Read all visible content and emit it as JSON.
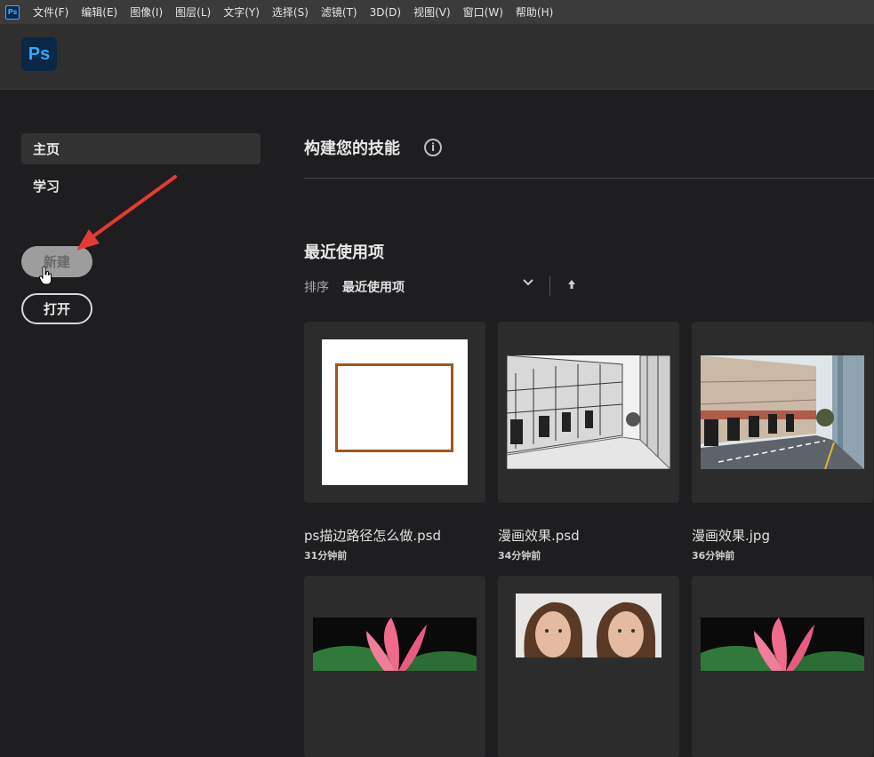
{
  "menubar": {
    "app_icon": "Ps",
    "items": [
      "文件(F)",
      "编辑(E)",
      "图像(I)",
      "图层(L)",
      "文字(Y)",
      "选择(S)",
      "滤镜(T)",
      "3D(D)",
      "视图(V)",
      "窗口(W)",
      "帮助(H)"
    ]
  },
  "header": {
    "logo": "Ps"
  },
  "sidebar": {
    "home": "主页",
    "learn": "学习",
    "new_button": "新建",
    "open_button": "打开"
  },
  "main": {
    "skills_title": "构建您的技能",
    "info_icon": "i",
    "recent_title": "最近使用项",
    "sort_label": "排序",
    "sort_value": "最近使用项",
    "sort_chevron": "⌄",
    "sort_direction": "↑",
    "files": [
      {
        "name": "ps描边路径怎么做.psd",
        "time": "31分钟前"
      },
      {
        "name": "漫画效果.psd",
        "time": "34分钟前"
      },
      {
        "name": "漫画效果.jpg",
        "time": "36分钟前"
      }
    ]
  },
  "colors": {
    "accent": "#31a8ff",
    "annotation_arrow": "#e53935",
    "frame_border": "#a0561d"
  }
}
